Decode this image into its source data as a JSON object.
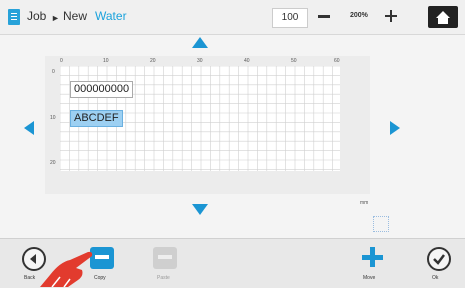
{
  "header": {
    "breadcrumb": [
      "Job",
      "New",
      "Water"
    ],
    "separator": "►",
    "zoom_value": "100",
    "zoom_label": "200%",
    "icons": {
      "doc": "document-icon",
      "minus": "minus-icon",
      "plus": "plus-icon",
      "home": "home-icon"
    }
  },
  "canvas": {
    "ruler_top_ticks": [
      "0",
      "10",
      "20",
      "30",
      "40",
      "50",
      "60"
    ],
    "ruler_left_ticks": [
      "0",
      "10",
      "20"
    ],
    "unit": "mm",
    "objects": [
      {
        "text": "000000000",
        "selected": false
      },
      {
        "text": "ABCDEF",
        "selected": true
      }
    ]
  },
  "bottom": {
    "back_label": "Back",
    "copy_label": "Copy",
    "paste_label": "Paste",
    "move_label": "Move",
    "ok_label": "Ok"
  },
  "colors": {
    "accent": "#1b95d3",
    "link": "#1aa2dc",
    "selection": "#9dd0f2"
  }
}
